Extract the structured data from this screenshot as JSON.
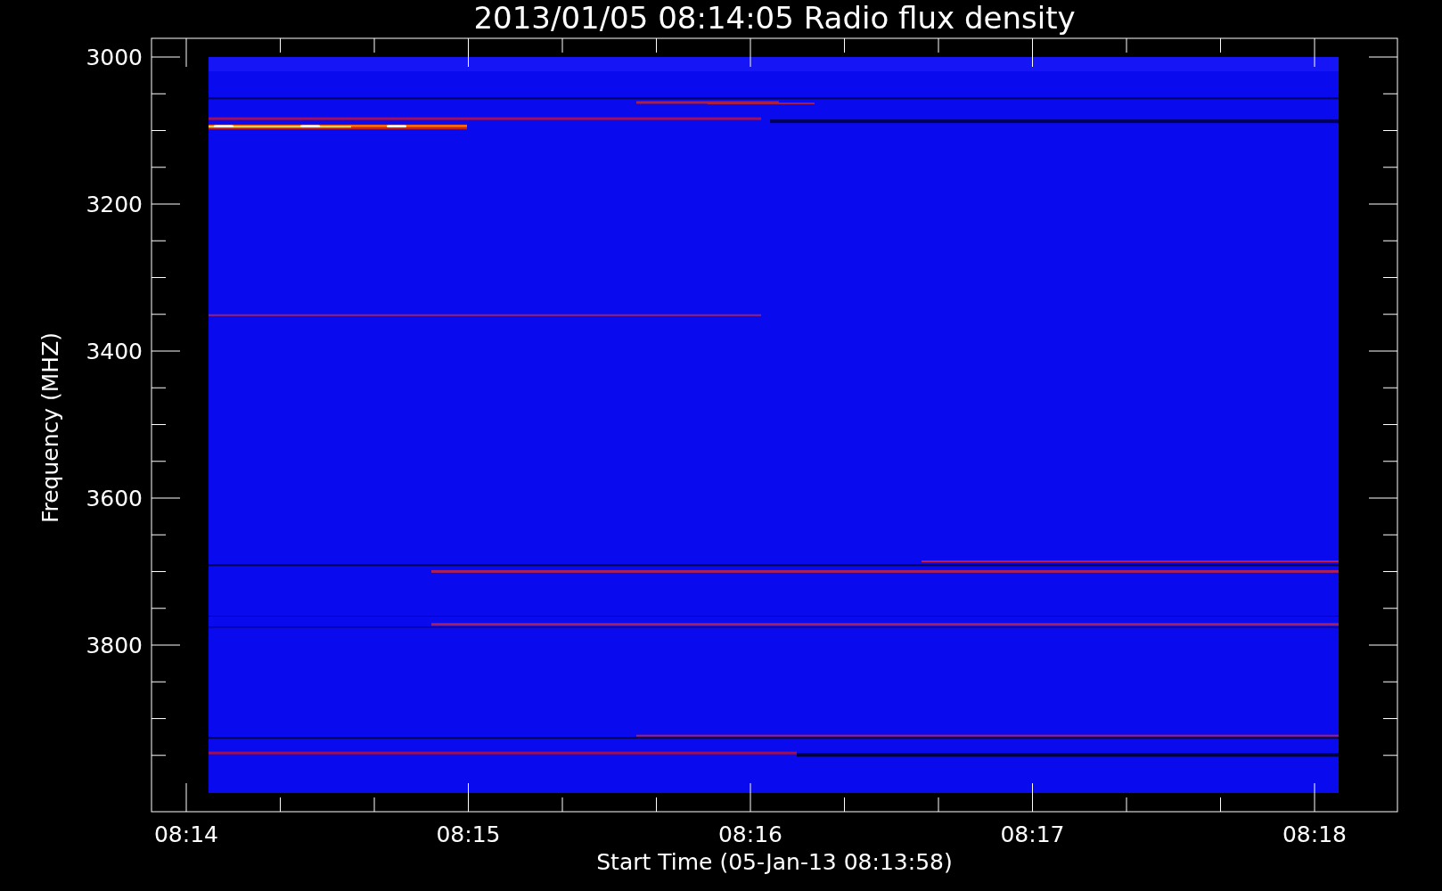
{
  "plot": {
    "title": "2013/01/05 08:14:05 Radio flux density",
    "ylabel": "Frequency (MHZ)",
    "xlabel": "Start Time (05-Jan-13 08:13:58)",
    "ytick_labels": [
      "3000",
      "3200",
      "3400",
      "3600",
      "3800"
    ],
    "xtick_labels": [
      "08:14",
      "08:15",
      "08:16",
      "08:17",
      "08:18"
    ]
  }
}
